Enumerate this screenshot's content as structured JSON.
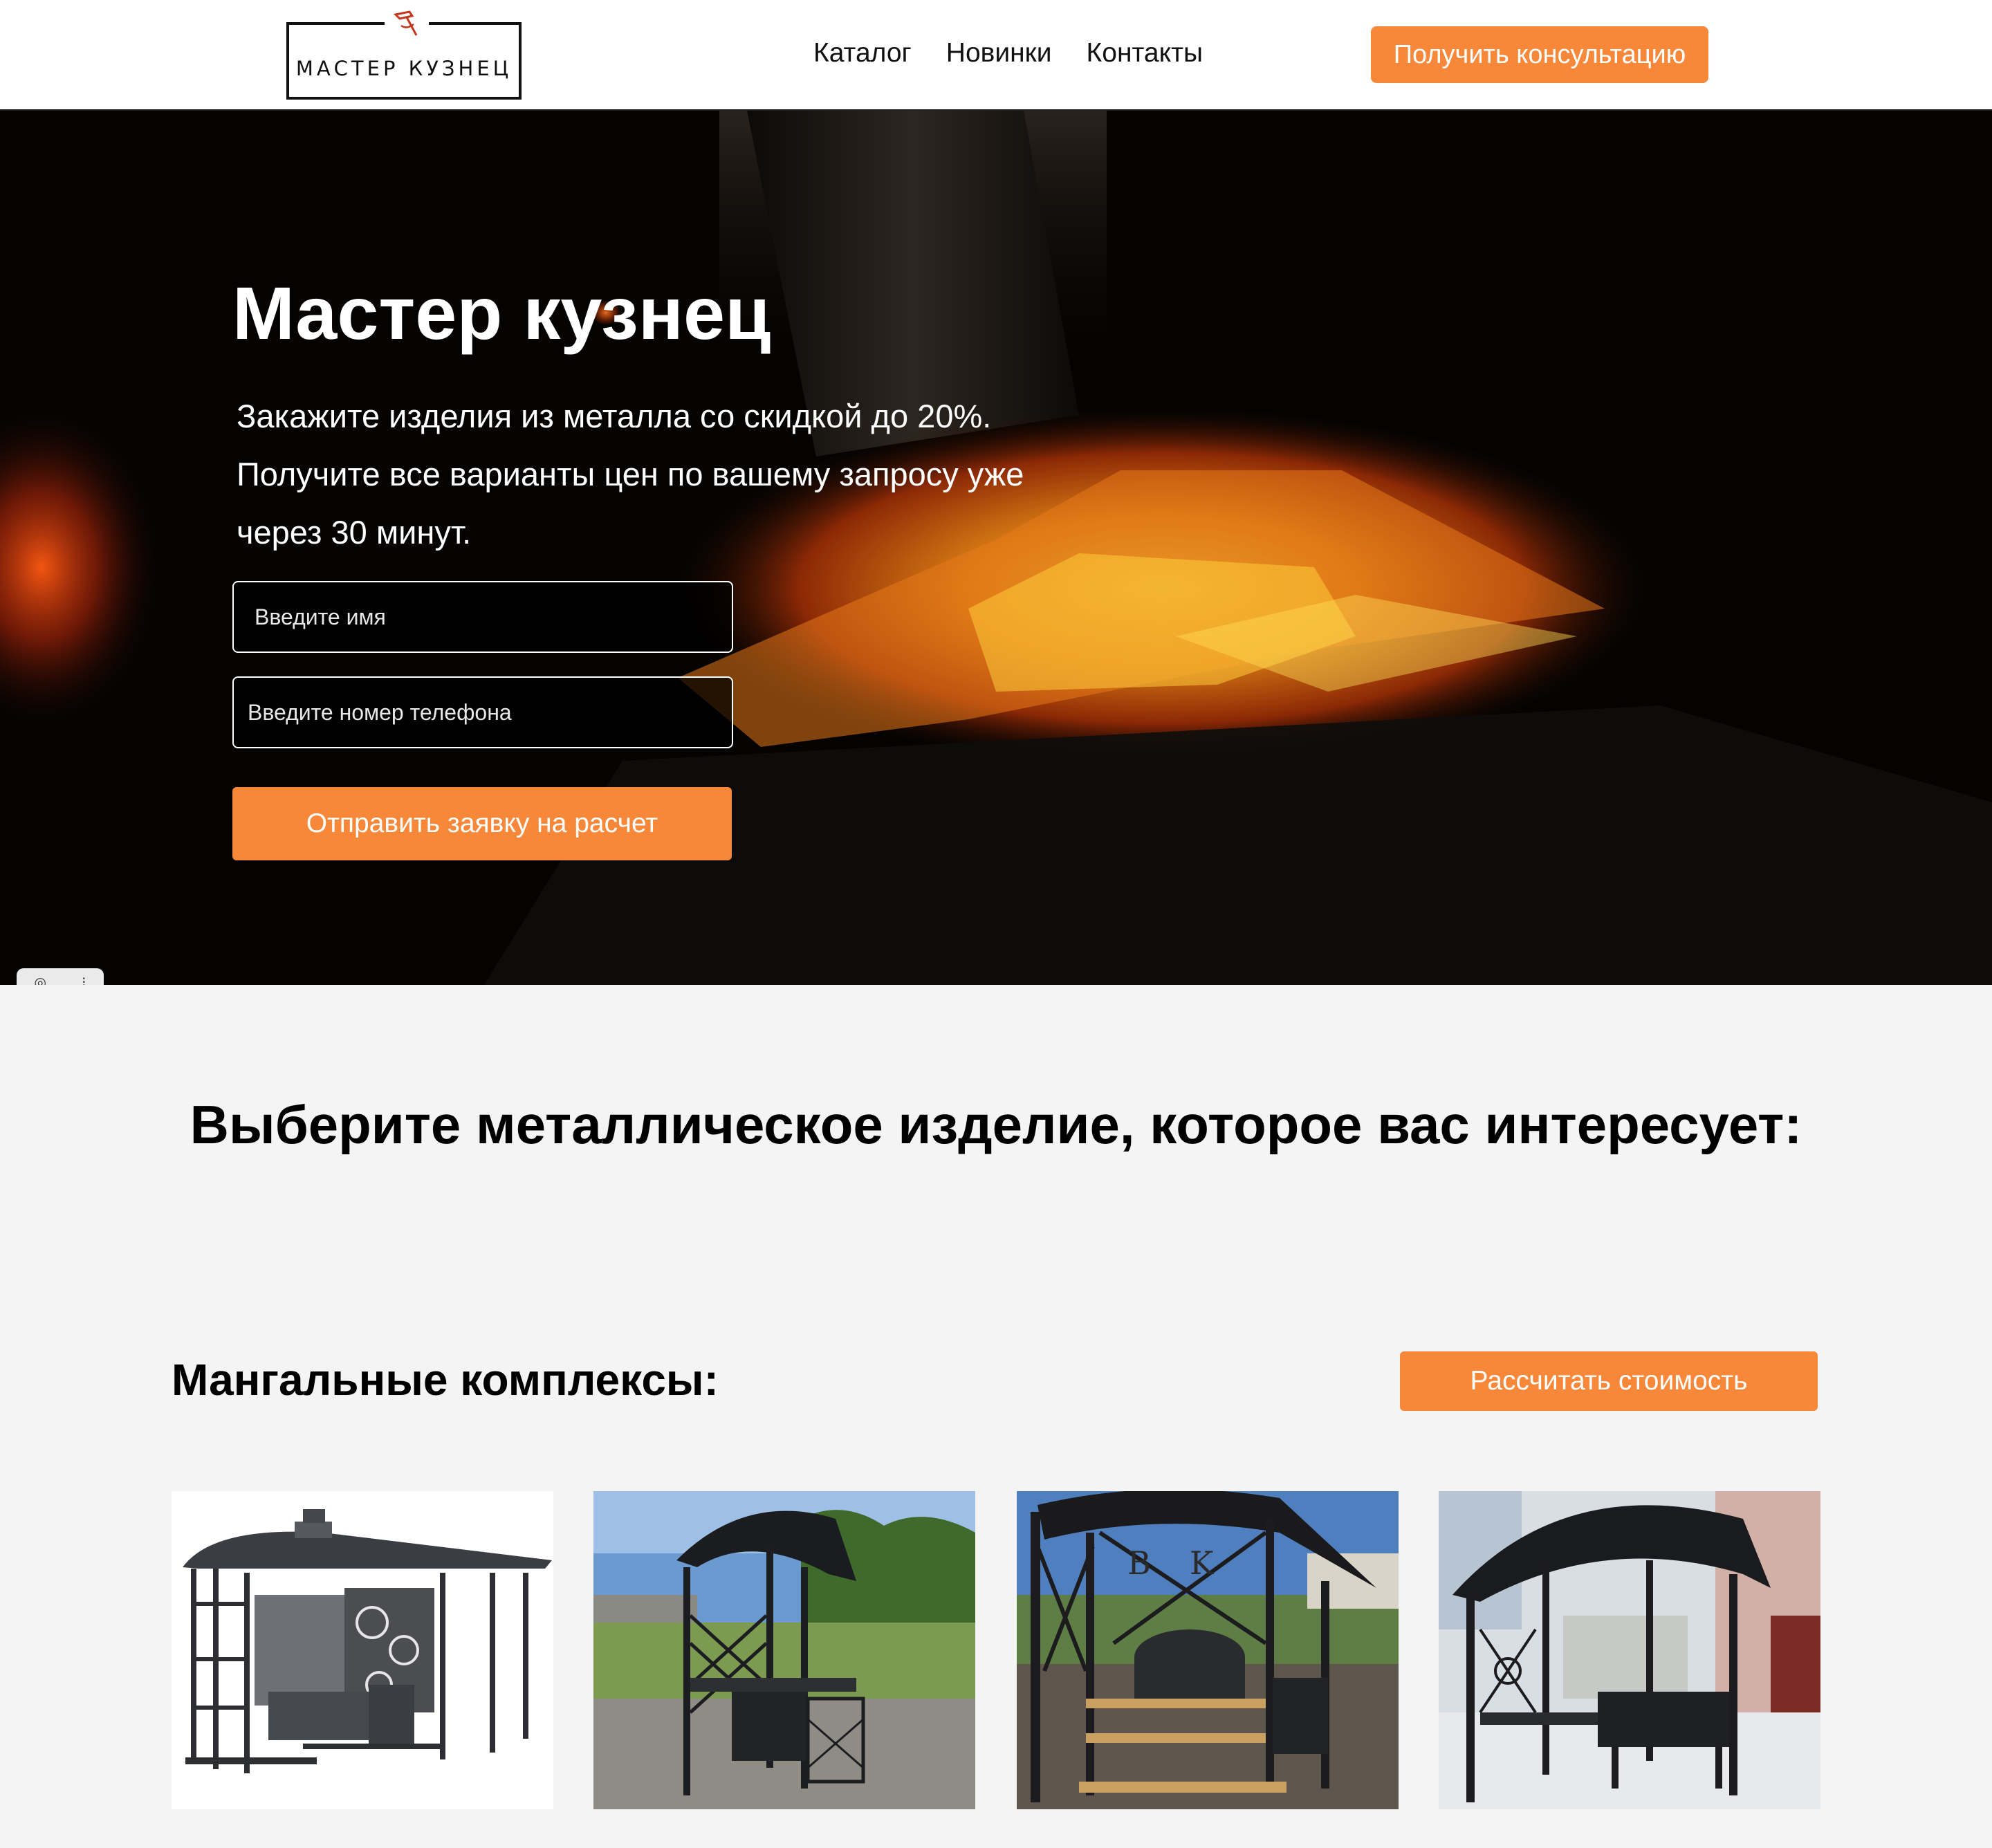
{
  "header": {
    "logo_text": "МАСТЕР КУЗНЕЦ",
    "nav": [
      {
        "label": "Каталог"
      },
      {
        "label": "Новинки"
      },
      {
        "label": "Контакты"
      }
    ],
    "cta_label": "Получить консультацию"
  },
  "hero": {
    "title": "Мастер кузнец",
    "subtitle_lines": [
      "Закажите изделия из металла со скидкой до 20%.",
      "Получите все варианты цен по вашему запросу уже",
      "через 30 минут."
    ],
    "name_placeholder": "Введите имя",
    "phone_placeholder": "Введите номер телефона",
    "submit_label": "Отправить заявку на расчет"
  },
  "catalog": {
    "title": "Выберите металлическое изделие, которое вас интересует:",
    "section": {
      "title": "Мангальные комплексы:",
      "button_label": "Рассчитать стоимость",
      "products": [
        {
          "image": "bbq-gazebo-white-background"
        },
        {
          "image": "bbq-gazebo-on-lawn"
        },
        {
          "image": "bbq-complex-with-smoker"
        },
        {
          "image": "bbq-gazebo-in-snow"
        }
      ]
    }
  },
  "colors": {
    "accent": "#f7883a",
    "header_bg": "#ffffff",
    "page_bg": "#f4f4f4",
    "hero_bg": "#050302"
  },
  "icons": {
    "logo_mark": "hammer-icon"
  }
}
